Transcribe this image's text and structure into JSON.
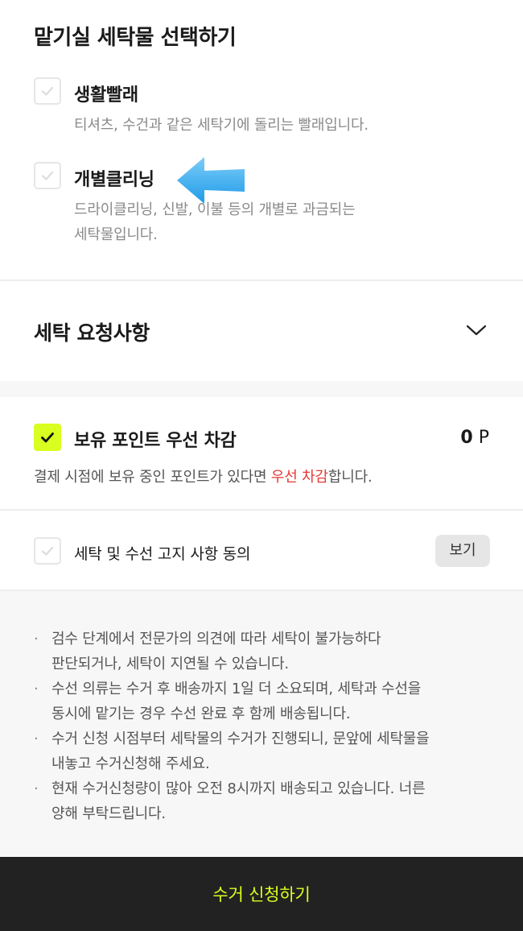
{
  "laundry": {
    "title": "맡기실 세탁물 선택하기",
    "options": [
      {
        "label": "생활빨래",
        "desc_lines": [
          "티셔츠, 수건과 같은 세탁기에 돌리는 빨래입니다."
        ],
        "checked": false
      },
      {
        "label": "개별클리닝",
        "desc_lines": [
          "드라이클리닝, 신발, 이불 등의 개별로 과금되는",
          "세탁물입니다."
        ],
        "checked": false
      }
    ]
  },
  "request": {
    "title": "세탁 요청사항"
  },
  "points": {
    "label": "보유 포인트 우선 차감",
    "value": "0",
    "unit": "P",
    "checked": true,
    "note_before": "결제 시점에 보유 중인 포인트가 있다면 ",
    "note_highlight": "우선 차감",
    "note_after": "합니다."
  },
  "agree": {
    "label": "세탁 및 수선 고지 사항 동의",
    "view_label": "보기",
    "checked": false
  },
  "notices": [
    [
      "검수 단계에서 전문가의 의견에 따라 세탁이 불가능하다",
      "판단되거나, 세탁이 지연될 수 있습니다."
    ],
    [
      "수선 의류는 수거 후 배송까지 1일 더 소요되며, 세탁과 수선을",
      "동시에 맡기는 경우 수선 완료 후 함께 배송됩니다."
    ],
    [
      "수거 신청 시점부터 세탁물의 수거가 진행되니, 문앞에 세탁물을",
      "내놓고 수거신청해 주세요."
    ],
    [
      "현재 수거신청량이 많아 오전 8시까지 배송되고 있습니다. 너른",
      "양해 부탁드립니다."
    ]
  ],
  "submit": {
    "label": "수거 신청하기"
  },
  "colors": {
    "accent": "#d8ff1f",
    "highlight_red": "#e53935",
    "bottom_bar": "#222222",
    "arrow_blue": "#2aa5ee"
  }
}
